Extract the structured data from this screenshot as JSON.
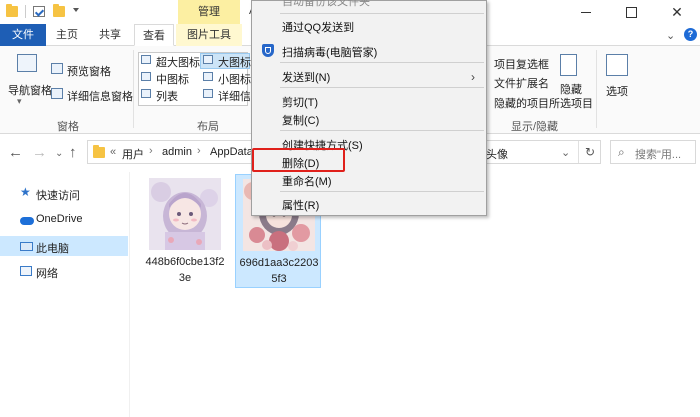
{
  "titlebar": {
    "manage_tab": "管理",
    "partial_title": "A"
  },
  "tabs": [
    "文件",
    "主页",
    "共享",
    "查看",
    "图片工具"
  ],
  "ribbon": {
    "pane_group": {
      "nav_pane": "导航窗格",
      "preview_pane": "预览窗格",
      "details_pane": "详细信息窗格",
      "label": "窗格"
    },
    "layout_group": {
      "items": [
        "超大图标",
        "大图标",
        "中图标",
        "小图标",
        "列表",
        "详细信息"
      ],
      "label": "布局"
    },
    "show_hide_group": {
      "item_checkboxes": "项目复选框",
      "file_ext": "文件扩展名",
      "hidden_items": "隐藏的项目",
      "hide_selected_1": "隐藏",
      "hide_selected_2": "所选项目",
      "label": "显示/隐藏"
    },
    "options": "选项"
  },
  "address": {
    "chevrons": "«",
    "crumbs": [
      "用户",
      "admin",
      "AppData"
    ],
    "trailing": "头像",
    "search_placeholder": "搜索\"用..."
  },
  "nav": {
    "items": [
      "快速访问",
      "OneDrive",
      "此电脑",
      "网络"
    ],
    "selected": "此电脑"
  },
  "files": [
    {
      "name": "448b6f0cbe13f23e",
      "selected": false
    },
    {
      "name": "696d1aa3c22035f3",
      "selected": true
    }
  ],
  "context_menu": {
    "items": [
      {
        "label": "自动备份该文件夹"
      },
      {
        "label": "通过QQ发送到"
      },
      {
        "label": "扫描病毒(电脑管家)"
      },
      {
        "label": "发送到(N)",
        "submenu": true
      },
      {
        "label": "剪切(T)"
      },
      {
        "label": "复制(C)"
      },
      {
        "label": "创建快捷方式(S)"
      },
      {
        "label": "删除(D)",
        "highlighted": true
      },
      {
        "label": "重命名(M)"
      },
      {
        "label": "属性(R)"
      }
    ],
    "highlight_color": "#e0201b"
  },
  "colors": {
    "file_tab": "#1e5eb5",
    "manage_tab": "#fcefa2",
    "selection": "#cce8ff"
  }
}
